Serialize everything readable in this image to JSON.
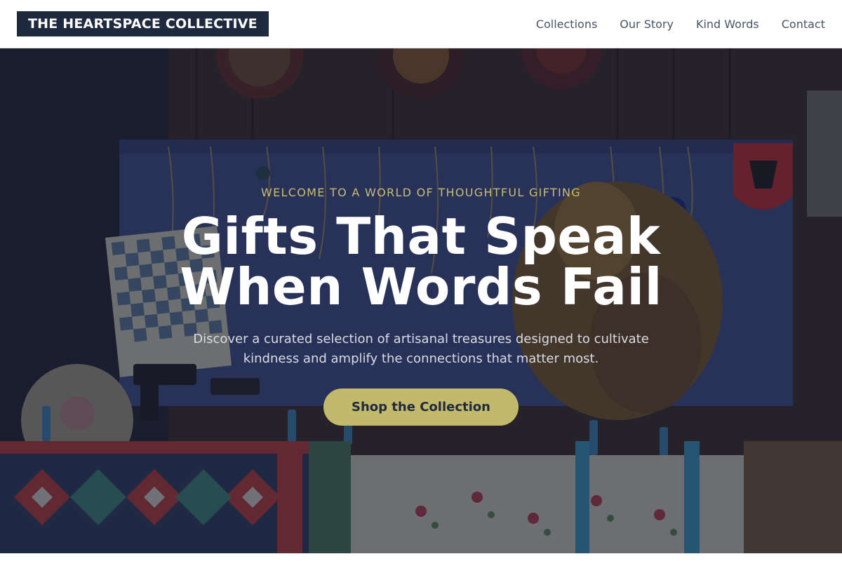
{
  "header": {
    "logo": "THE HEARTSPACE COLLECTIVE",
    "nav": [
      {
        "label": "Collections"
      },
      {
        "label": "Our Story"
      },
      {
        "label": "Kind Words"
      },
      {
        "label": "Contact"
      }
    ]
  },
  "hero": {
    "eyebrow": "WELCOME TO A WORLD OF THOUGHTFUL GIFTING",
    "headline_line1": "Gifts That Speak",
    "headline_line2": "When Words Fail",
    "subhead": "Discover a curated selection of artisanal treasures designed to cultivate kindness and amplify the connections that matter most.",
    "cta_label": "Shop the Collection"
  },
  "colors": {
    "brand_navy": "#1f2a3f",
    "accent_gold": "#c3b96d",
    "eyebrow_gold": "#c9bd74",
    "nav_text": "#4b5563"
  }
}
